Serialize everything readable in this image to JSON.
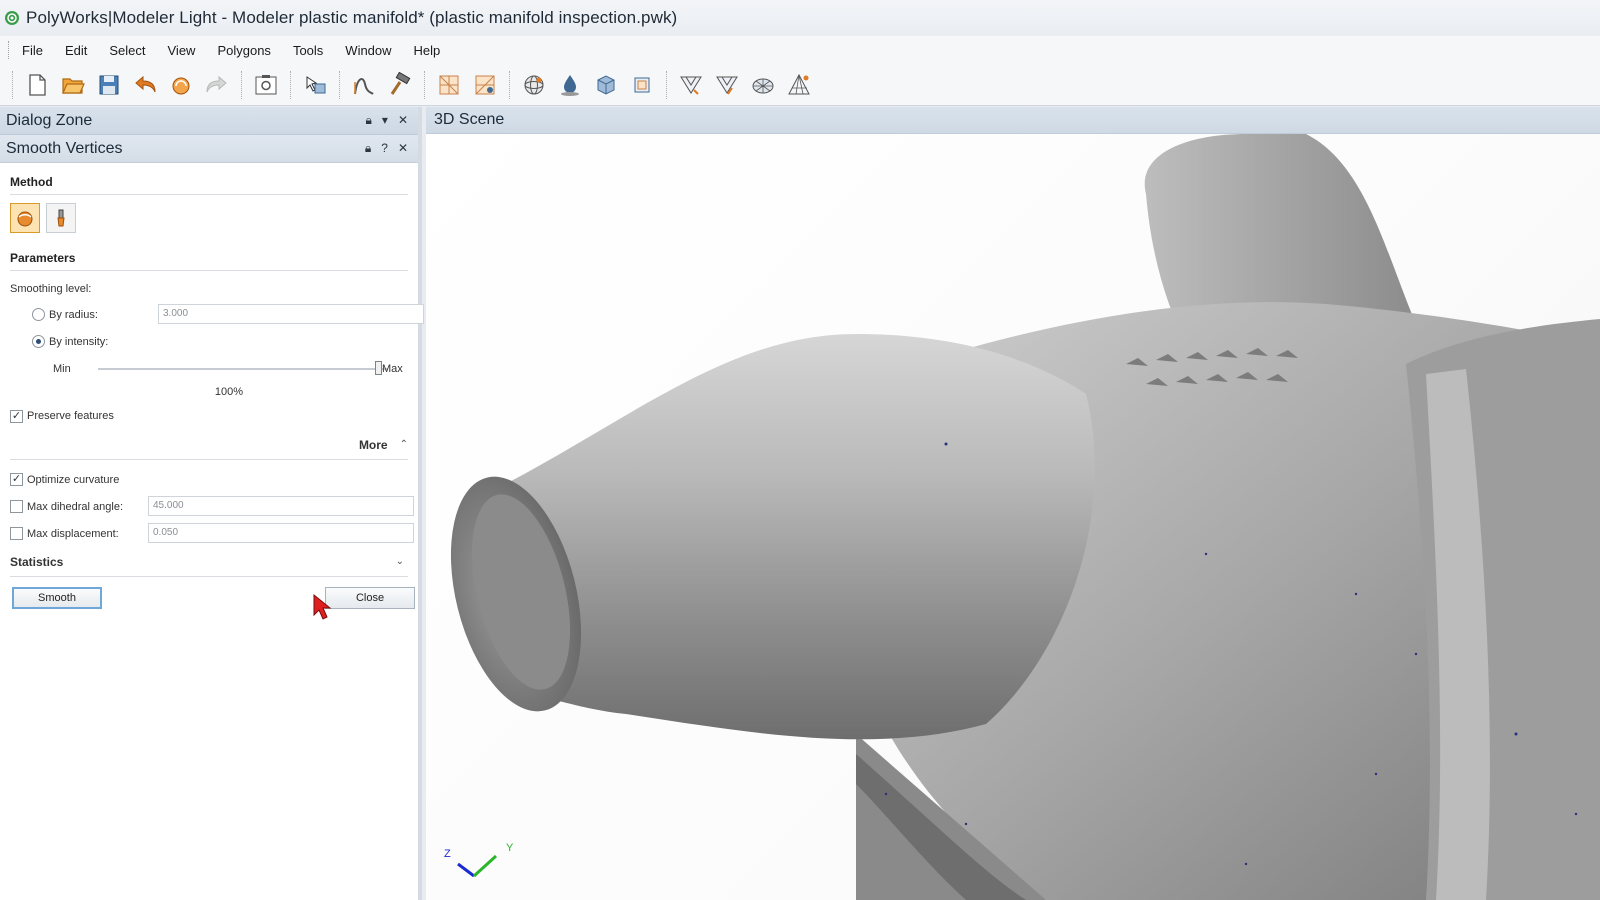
{
  "window": {
    "title": "PolyWorks|Modeler Light - Modeler plastic manifold* (plastic manifold inspection.pwk)"
  },
  "menu": [
    "File",
    "Edit",
    "Select",
    "View",
    "Polygons",
    "Tools",
    "Window",
    "Help"
  ],
  "toolbar": {
    "icons": [
      "new-file-icon",
      "open-folder-icon",
      "save-icon",
      "undo-icon",
      "reset-icon",
      "redo-icon",
      "screenshot-icon",
      "select-tool-icon",
      "curve-tool-icon",
      "hammer-icon",
      "mesh-edit-icon",
      "mesh-edit-2-icon",
      "sphere-icon",
      "fill-holes-icon",
      "cube-icon",
      "box-icon",
      "reduce-icon",
      "reduce-2-icon",
      "globe-icon",
      "triangle-icon"
    ]
  },
  "dialog_zone": {
    "title": "Dialog Zone",
    "controls": [
      "lock",
      "dropdown",
      "close"
    ]
  },
  "smooth_vertices": {
    "title": "Smooth Vertices",
    "controls": [
      "lock",
      "help",
      "close"
    ],
    "method": {
      "section_label": "Method",
      "icons": [
        "smooth-method-icon",
        "brush-method-icon"
      ],
      "active_index": 0
    },
    "parameters": {
      "section_label": "Parameters",
      "smoothing_level_label": "Smoothing level:",
      "by_radius_label": "By radius:",
      "by_radius_value": "3.000",
      "by_radius_selected": false,
      "by_intensity_label": "By intensity:",
      "by_intensity_selected": true,
      "slider_min_label": "Min",
      "slider_max_label": "Max",
      "slider_value_label": "100%",
      "slider_fraction": 1.0,
      "preserve_features_label": "Preserve features",
      "preserve_features_checked": true
    },
    "more": {
      "label": "More",
      "expanded": true,
      "optimize_curvature_label": "Optimize curvature",
      "optimize_curvature_checked": true,
      "max_dihedral_label": "Max dihedral angle:",
      "max_dihedral_value": "45.000",
      "max_dihedral_checked": false,
      "max_displacement_label": "Max displacement:",
      "max_displacement_value": "0.050",
      "max_displacement_checked": false
    },
    "statistics": {
      "section_label": "Statistics"
    },
    "buttons": {
      "smooth_label": "Smooth",
      "close_label": "Close"
    }
  },
  "scene": {
    "title": "3D Scene",
    "axis_labels": {
      "z": "Z",
      "y": "Y"
    }
  },
  "colors": {
    "accent_orange": "#e67e22",
    "header_blue": "#d3dde8",
    "cursor_red": "#e02020"
  }
}
